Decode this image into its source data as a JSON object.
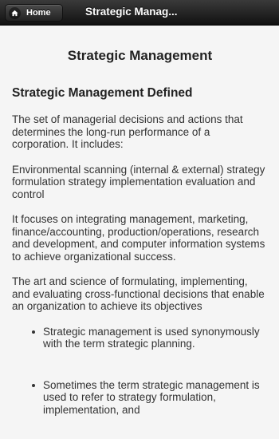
{
  "header": {
    "home_label": "Home",
    "title": "Strategic Manag..."
  },
  "main": {
    "page_title": "Strategic Management",
    "section_heading": "Strategic Management Defined",
    "paragraphs": [
      "The set of managerial decisions and actions that determines the long-run performance of a corporation. It includes:",
      "Environmental scanning (internal & external) strategy formulation strategy implementation evaluation and control",
      "It focuses on integrating management, marketing, finance/accounting, production/operations, research and development, and computer information systems to achieve organizational success.",
      "The art and science of formulating, implementing, and evaluating cross-functional decisions that enable an organization to achieve its objectives"
    ],
    "bullets": [
      "Strategic management is used synonymously with the term strategic planning.",
      "Sometimes the term strategic management is used to refer to strategy formulation, implementation, and"
    ]
  }
}
